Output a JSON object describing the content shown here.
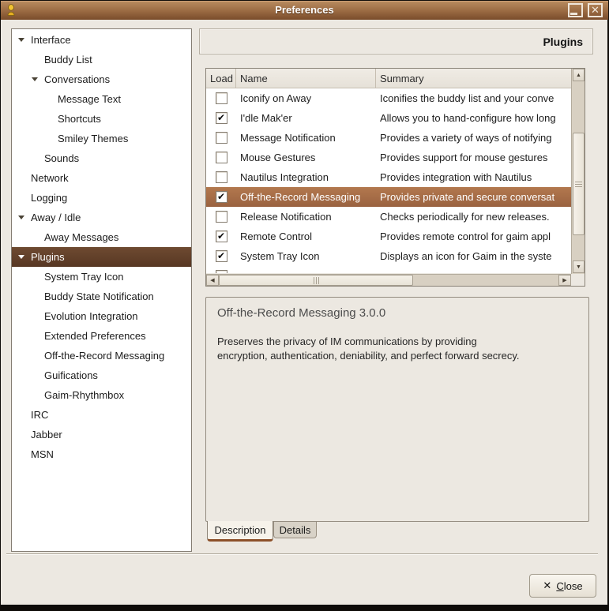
{
  "colors": {
    "titlebar_top": "#b98c60",
    "titlebar_mid": "#9a6a42",
    "titlebar_bottom": "#794c2b",
    "window_bg": "#ece8e1",
    "sidebar_sel_top": "#6e4a31",
    "sidebar_sel_bottom": "#573723",
    "row_sel_top": "#b3784e",
    "row_sel_bottom": "#9a6240",
    "tab_accent": "#8c5029",
    "scroll_trough": "#d8d0c2"
  },
  "icons": {
    "app_icon": "gaim-buddy",
    "window_close_glyph": "✕",
    "check_glyph": "✔",
    "scroll_up_glyph": "▲",
    "scroll_down_glyph": "▼",
    "scroll_left_glyph": "◀",
    "scroll_right_glyph": "▶",
    "close_button_glyph": "✕"
  },
  "window": {
    "title": "Preferences"
  },
  "sidebar": {
    "items": [
      {
        "label": "Interface",
        "level": 0,
        "expanded": true
      },
      {
        "label": "Buddy List",
        "level": 1
      },
      {
        "label": "Conversations",
        "level": 1,
        "expanded": true
      },
      {
        "label": "Message Text",
        "level": 2
      },
      {
        "label": "Shortcuts",
        "level": 2
      },
      {
        "label": "Smiley Themes",
        "level": 2
      },
      {
        "label": "Sounds",
        "level": 1
      },
      {
        "label": "Network",
        "level": 0
      },
      {
        "label": "Logging",
        "level": 0
      },
      {
        "label": "Away / Idle",
        "level": 0,
        "expanded": true
      },
      {
        "label": "Away Messages",
        "level": 1
      },
      {
        "label": "Plugins",
        "level": 0,
        "expanded": true,
        "selected": true
      },
      {
        "label": "System Tray Icon",
        "level": 1
      },
      {
        "label": "Buddy State Notification",
        "level": 1
      },
      {
        "label": "Evolution Integration",
        "level": 1
      },
      {
        "label": "Extended Preferences",
        "level": 1
      },
      {
        "label": "Off-the-Record Messaging",
        "level": 1
      },
      {
        "label": "Guifications",
        "level": 1
      },
      {
        "label": "Gaim-Rhythmbox",
        "level": 1
      },
      {
        "label": "IRC",
        "level": 0
      },
      {
        "label": "Jabber",
        "level": 0
      },
      {
        "label": "MSN",
        "level": 0
      }
    ]
  },
  "panel": {
    "title": "Plugins"
  },
  "table": {
    "columns": [
      "Load",
      "Name",
      "Summary"
    ],
    "rows": [
      {
        "loaded": false,
        "name": "Iconify on Away",
        "summary": "Iconifies the buddy list and your conve"
      },
      {
        "loaded": true,
        "name": "I'dle Mak'er",
        "summary": "Allows you to hand-configure how long"
      },
      {
        "loaded": false,
        "name": "Message Notification",
        "summary": "Provides a variety of ways of notifying"
      },
      {
        "loaded": false,
        "name": "Mouse Gestures",
        "summary": "Provides support for mouse gestures"
      },
      {
        "loaded": false,
        "name": "Nautilus Integration",
        "summary": "Provides integration with Nautilus"
      },
      {
        "loaded": true,
        "name": "Off-the-Record Messaging",
        "summary": "Provides private and secure conversat",
        "selected": true
      },
      {
        "loaded": false,
        "name": "Release Notification",
        "summary": "Checks periodically for new releases."
      },
      {
        "loaded": true,
        "name": "Remote Control",
        "summary": "Provides remote control for gaim appl"
      },
      {
        "loaded": true,
        "name": "System Tray Icon",
        "summary": "Displays an icon for Gaim in the syste"
      },
      {
        "loaded": false,
        "name": "",
        "summary": ""
      }
    ]
  },
  "description": {
    "title": "Off-the-Record Messaging 3.0.0",
    "body": "Preserves the privacy of IM communications by providing encryption, authentication, deniability, and perfect forward secrecy."
  },
  "tabs": [
    {
      "label": "Description",
      "active": true
    },
    {
      "label": "Details",
      "active": false
    }
  ],
  "close_button": {
    "mnemonic": "C",
    "rest": "lose"
  }
}
